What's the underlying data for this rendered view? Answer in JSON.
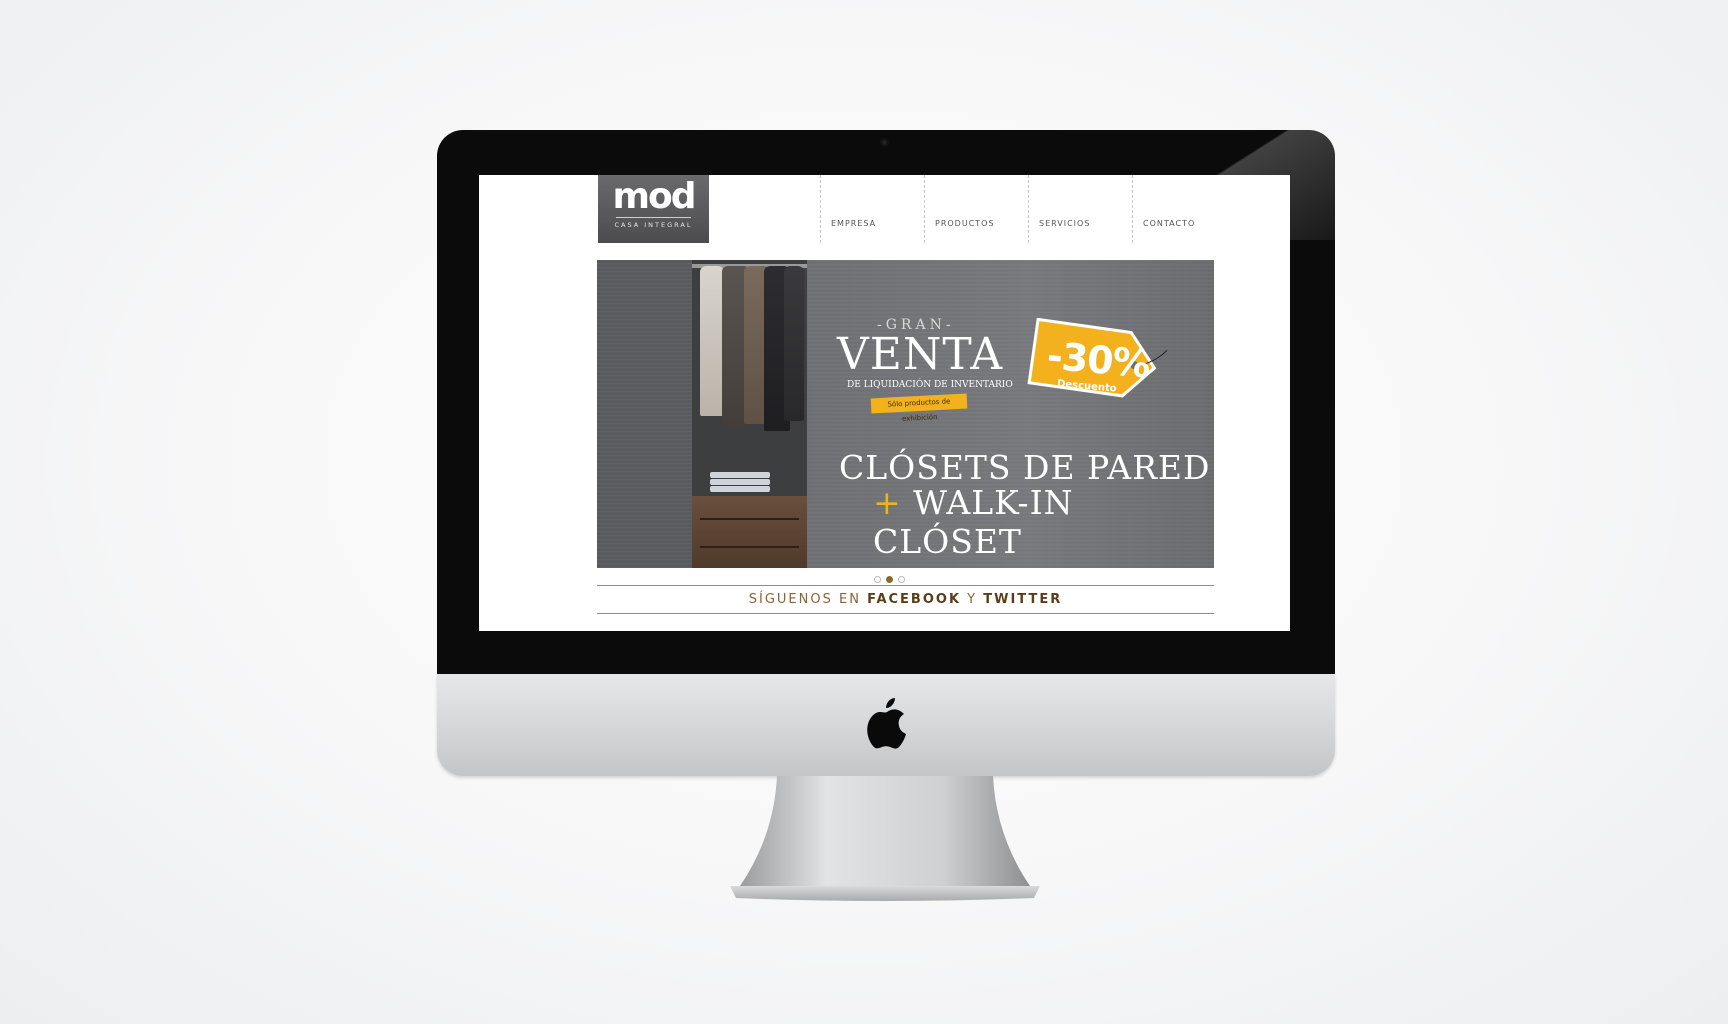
{
  "site": {
    "logo": {
      "word": "mod",
      "tagline": "CASA INTEGRAL"
    },
    "nav": [
      "EMPRESA",
      "PRODUCTOS",
      "SERVICIOS",
      "CONTACTO"
    ],
    "hero": {
      "gran": "-GRAN-",
      "venta": "VENTA",
      "venta_sub": "DE LIQUIDACIÓN DE INVENTARIO",
      "badge": "Sólo productos de exhibición",
      "discount": "-30%",
      "discount_label": "Descuento",
      "line1": "CLÓSETS DE PARED",
      "plus": "+",
      "line2": "WALK-IN CLÓSET"
    },
    "slider": {
      "count": 3,
      "active": 2
    },
    "follow": {
      "prefix": "SÍGUENOS EN",
      "facebook": "FACEBOOK",
      "and": "Y",
      "twitter": "TWITTER"
    },
    "colors": {
      "accent": "#f3b21d",
      "brown": "#8a6436",
      "logo_bg": "#58585a"
    }
  }
}
